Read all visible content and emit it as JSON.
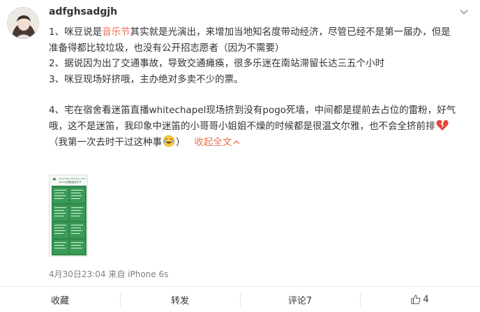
{
  "user": {
    "name": "adfghsadgjh"
  },
  "post": {
    "line1_a": "1、咪豆说是",
    "line1_highlight": "音乐节",
    "line1_b": "其实就是光演出，来增加当地知名度带动经济，尽管已经不是第一届办，但是",
    "line2": "准备得都比较垃圾，也没有公开招志愿者（因为不需要）",
    "line3": "2、据说因为出了交通事故，导致交通瘫痪，很多乐迷在南站滞留长达三五个小时",
    "line4": "3、咪豆现场好挤哦，主办绝对多卖不少的票。",
    "line5": "4、宅在宿舍看迷笛直播whitechapel现场挤到没有pogo死墙，中间都是提前去占位的雷粉，好气",
    "line6": "哦，这不是迷笛，我印象中迷笛的小哥哥小姐姐不燥的时候都是很温文尔雅，也不会全挤前排",
    "line7_a": "（我第一次去时干过这种事",
    "line7_b": "）",
    "collapse": "收起全文"
  },
  "thumbnail": {
    "header_line1": "TAIHU MIDI FESTIVAL 2017",
    "header_line2": "2017太湖迷笛音乐节"
  },
  "meta": {
    "time": "4月30日23:04",
    "source": "来自 iPhone 6s"
  },
  "actions": {
    "favorite": "收藏",
    "repost": "转发",
    "comment": "评论7",
    "like_count": "4"
  },
  "colors": {
    "accent": "#eb7350",
    "text": "#333333",
    "muted": "#808080"
  }
}
